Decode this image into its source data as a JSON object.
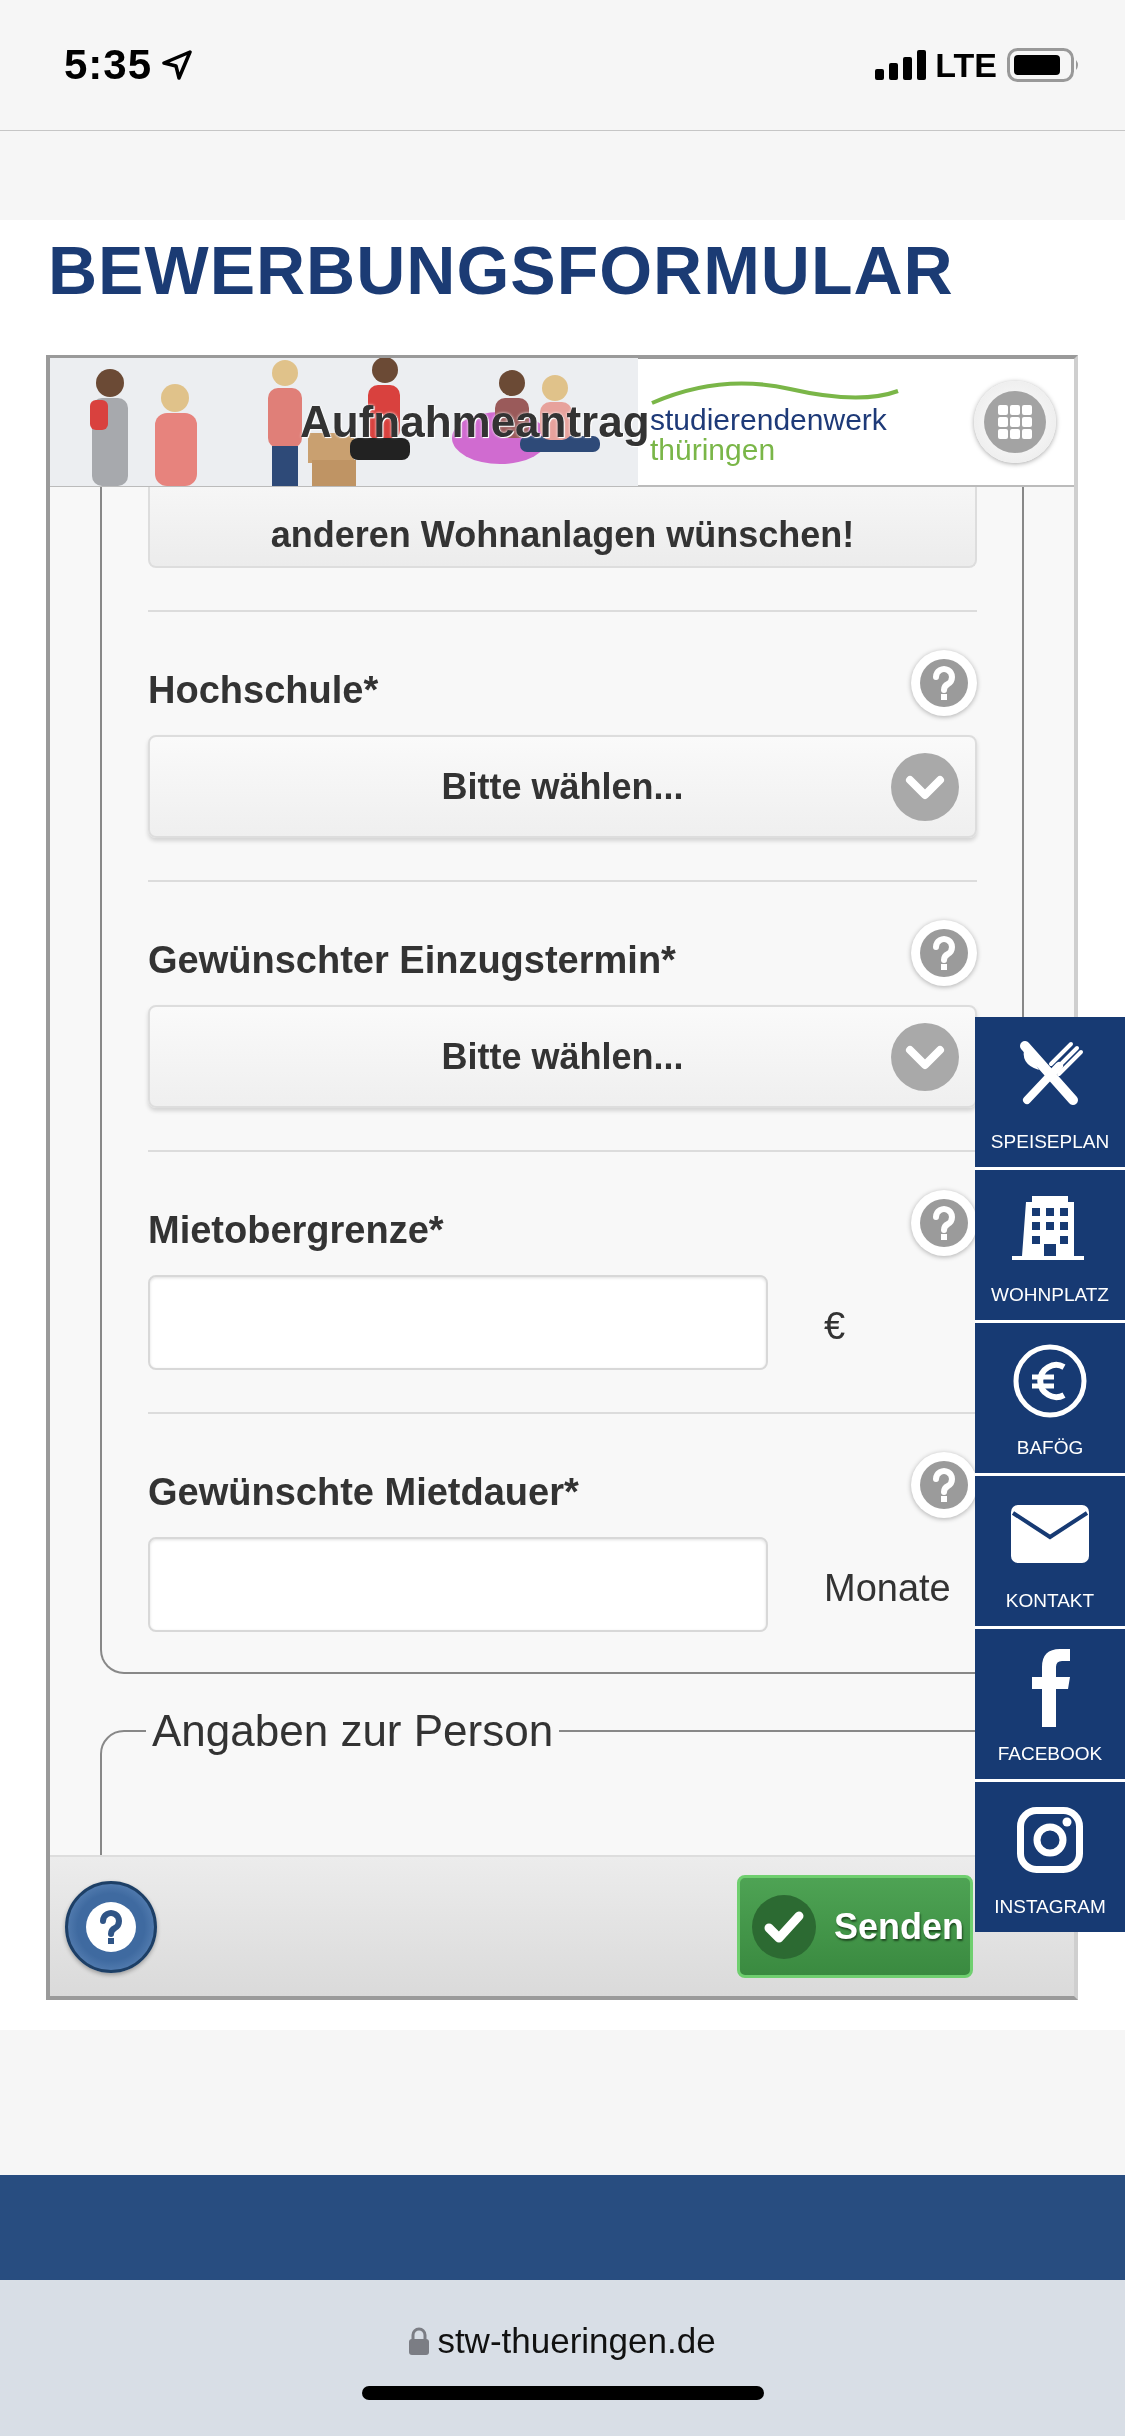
{
  "status_bar": {
    "time": "5:35",
    "network": "LTE"
  },
  "page": {
    "title": "BEWERBUNGSFORMULAR"
  },
  "form": {
    "header": {
      "title": "Aufnahmeantrag",
      "logo_line_1": "studierendenwerk",
      "logo_line_2": "thüringen"
    },
    "top_button": "anderen Wohnanlagen wünschen!",
    "fields": [
      {
        "kind": "select",
        "label": "Hochschule*",
        "value": "Bitte wählen..."
      },
      {
        "kind": "select",
        "label": "Gewünschter Einzugstermin*",
        "value": "Bitte wählen..."
      },
      {
        "kind": "input",
        "label": "Mietobergrenze*",
        "unit": "€"
      },
      {
        "kind": "input",
        "label": "Gewünschte Mietdauer*",
        "unit": "Monate"
      }
    ],
    "next_section": {
      "legend": "Angaben zur Person"
    },
    "toolbar": {
      "submit": "Senden"
    }
  },
  "side_nav": [
    {
      "kind": "cutlery",
      "label": "SPEISEPLAN"
    },
    {
      "kind": "building",
      "label": "WOHNPLATZ"
    },
    {
      "kind": "euro",
      "label": "BAFÖG"
    },
    {
      "kind": "mail",
      "label": "KONTAKT"
    },
    {
      "kind": "facebook",
      "label": "FACEBOOK"
    },
    {
      "kind": "instagram",
      "label": "INSTAGRAM"
    }
  ],
  "browser": {
    "url": "stw-thueringen.de"
  }
}
